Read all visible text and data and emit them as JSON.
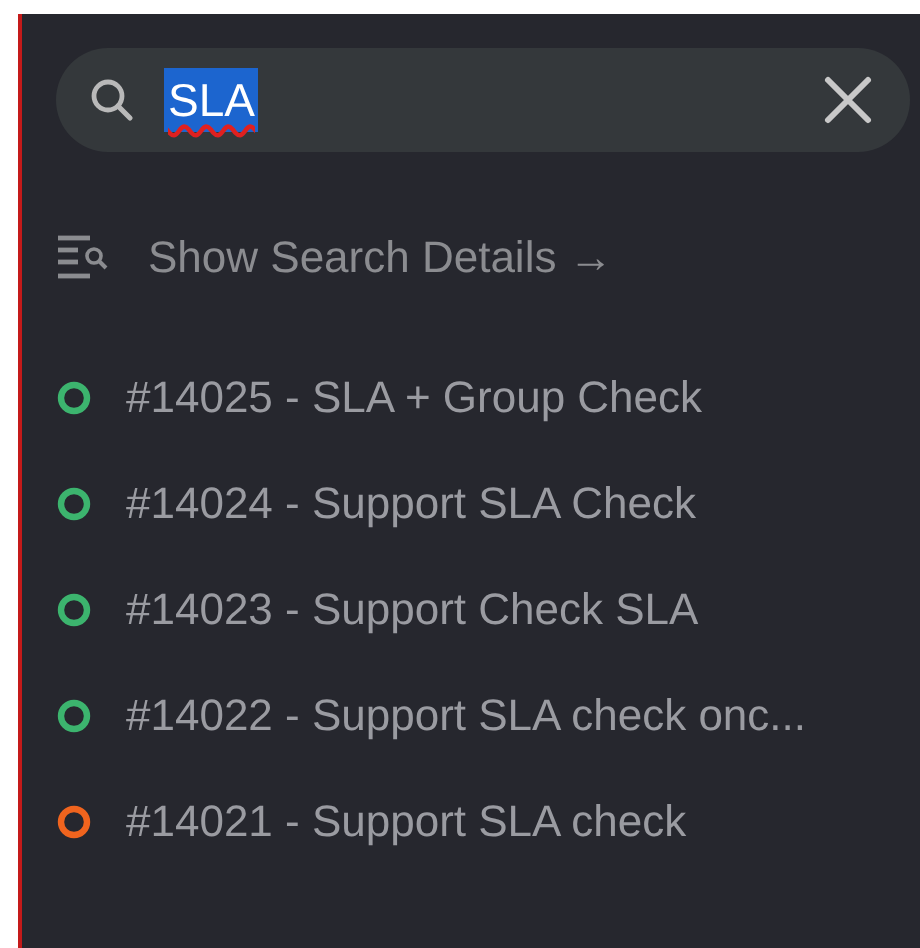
{
  "search": {
    "value": "SLA",
    "text_selected": true,
    "misspelled": true
  },
  "details_link": {
    "label": "Show Search Details →"
  },
  "results": [
    {
      "label": "#14025 - SLA + Group Check",
      "color": "#3cb46e"
    },
    {
      "label": "#14024 - Support SLA Check",
      "color": "#3cb46e"
    },
    {
      "label": "#14023 - Support Check SLA",
      "color": "#3cb46e"
    },
    {
      "label": "#14022 - Support SLA check onc...",
      "color": "#3cb46e"
    },
    {
      "label": "#14021 - Support SLA check",
      "color": "#f0641e"
    }
  ]
}
